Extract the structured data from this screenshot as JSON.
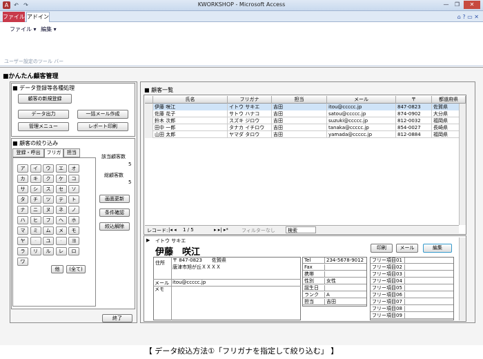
{
  "window": {
    "title": "KWORKSHOP - Microsoft Access",
    "minimize": "—",
    "restore": "❐",
    "close": "✕"
  },
  "quick_access": {
    "icons": [
      "access-icon",
      "undo-icon",
      "redo-icon"
    ],
    "glyphs": [
      "A",
      "↶",
      "↷"
    ]
  },
  "ribbon": {
    "tab_file": "ファイル",
    "tab_addin": "アドイン",
    "menu_file": "ファイル ▾",
    "menu_edit": "編集 ▾",
    "group": "ユーザー設定のツール バー",
    "right_icons": "⌂ ? ▭ ✕"
  },
  "app": {
    "title": "■かんたん顧客管理"
  },
  "left": {
    "section1": "■ データ登録等各種処理",
    "btn_new": "顧客の新規登録",
    "btn_export": "データ出力",
    "btn_mail": "一括メール作成",
    "btn_admin": "管理メニュー",
    "btn_report": "レポート印刷",
    "section2": "■ 顧客の絞り込み",
    "tabs": [
      "登録・呼出",
      "フリガナ",
      "担当"
    ],
    "kana": [
      [
        "ア",
        "イ",
        "ウ",
        "エ",
        "オ"
      ],
      [
        "カ",
        "キ",
        "ク",
        "ケ",
        "コ"
      ],
      [
        "サ",
        "シ",
        "ス",
        "セ",
        "ソ"
      ],
      [
        "タ",
        "チ",
        "ツ",
        "テ",
        "ト"
      ],
      [
        "ナ",
        "ニ",
        "ヌ",
        "ネ",
        "ノ"
      ],
      [
        "ハ",
        "ヒ",
        "フ",
        "ヘ",
        "ホ"
      ],
      [
        "マ",
        "ミ",
        "ム",
        "メ",
        "モ"
      ],
      [
        "ヤ",
        "-",
        "ユ",
        "-",
        "ヨ"
      ],
      [
        "ラ",
        "リ",
        "ル",
        "レ",
        "ロ"
      ],
      [
        "ワ"
      ]
    ],
    "btn_other": "他",
    "btn_all": "(全て)",
    "count_label": "該当顧客数",
    "count_value": "5",
    "total_label": "総顧客数",
    "total_value": "5",
    "btn_refresh": "画面更新",
    "btn_cond": "条件確認",
    "btn_clear": "絞込解除",
    "btn_end": "終了"
  },
  "list": {
    "title": "■ 顧客一覧",
    "headers": [
      "氏名",
      "フリガナ",
      "担当",
      "メール",
      "〒",
      "都道府県"
    ],
    "rows": [
      [
        "伊藤 咲江",
        "イトウ サキエ",
        "吉田",
        "itou@ccccc.jp",
        "847-0823",
        "佐賀県"
      ],
      [
        "佐藤 花子",
        "サトウ ハナコ",
        "吉田",
        "satou@ccccc.jp",
        "874-0902",
        "大分県"
      ],
      [
        "鈴木 次郎",
        "スズキ ジロウ",
        "吉田",
        "suzuki@ccccc.jp",
        "812-0032",
        "福岡県"
      ],
      [
        "田中 一郎",
        "タナカ イチロウ",
        "吉田",
        "tanaka@ccccc.jp",
        "854-0027",
        "長崎県"
      ],
      [
        "山田 太郎",
        "ヤマダ タロウ",
        "吉田",
        "yamada@ccccc.jp",
        "812-0884",
        "福岡県"
      ]
    ],
    "nav_record": "レコード: ",
    "nav_pos": "1 / 5",
    "nav_filter": "フィルターなし",
    "nav_search": "検索"
  },
  "detail": {
    "kana": "イトウ サキエ",
    "name": "伊藤　咲江",
    "btn_print": "印刷",
    "btn_mail": "メール",
    "btn_edit": "編集",
    "addr_label": "住所",
    "zip": "〒 847-0823　　佐賀県",
    "address": "唐津市旭が丘ＸＸＸＸ",
    "mail_label": "メール",
    "mail": "itou@ccccc.jp",
    "memo_label": "メモ",
    "fields": [
      [
        "Tel",
        "234-5678-9012"
      ],
      [
        "Fax",
        ""
      ],
      [
        "携帯",
        ""
      ],
      [
        "性別",
        "女性"
      ],
      [
        "誕生日",
        ""
      ],
      [
        "ランク",
        "A"
      ],
      [
        "担当",
        "吉田"
      ]
    ],
    "free": [
      "フリー項目01",
      "フリー項目02",
      "フリー項目03",
      "フリー項目04",
      "フリー項目05",
      "フリー項目06",
      "フリー項目07",
      "フリー項目08",
      "フリー項目09"
    ]
  },
  "caption": "【 データ絞込方法①「フリガナを指定して絞り込む」 】"
}
